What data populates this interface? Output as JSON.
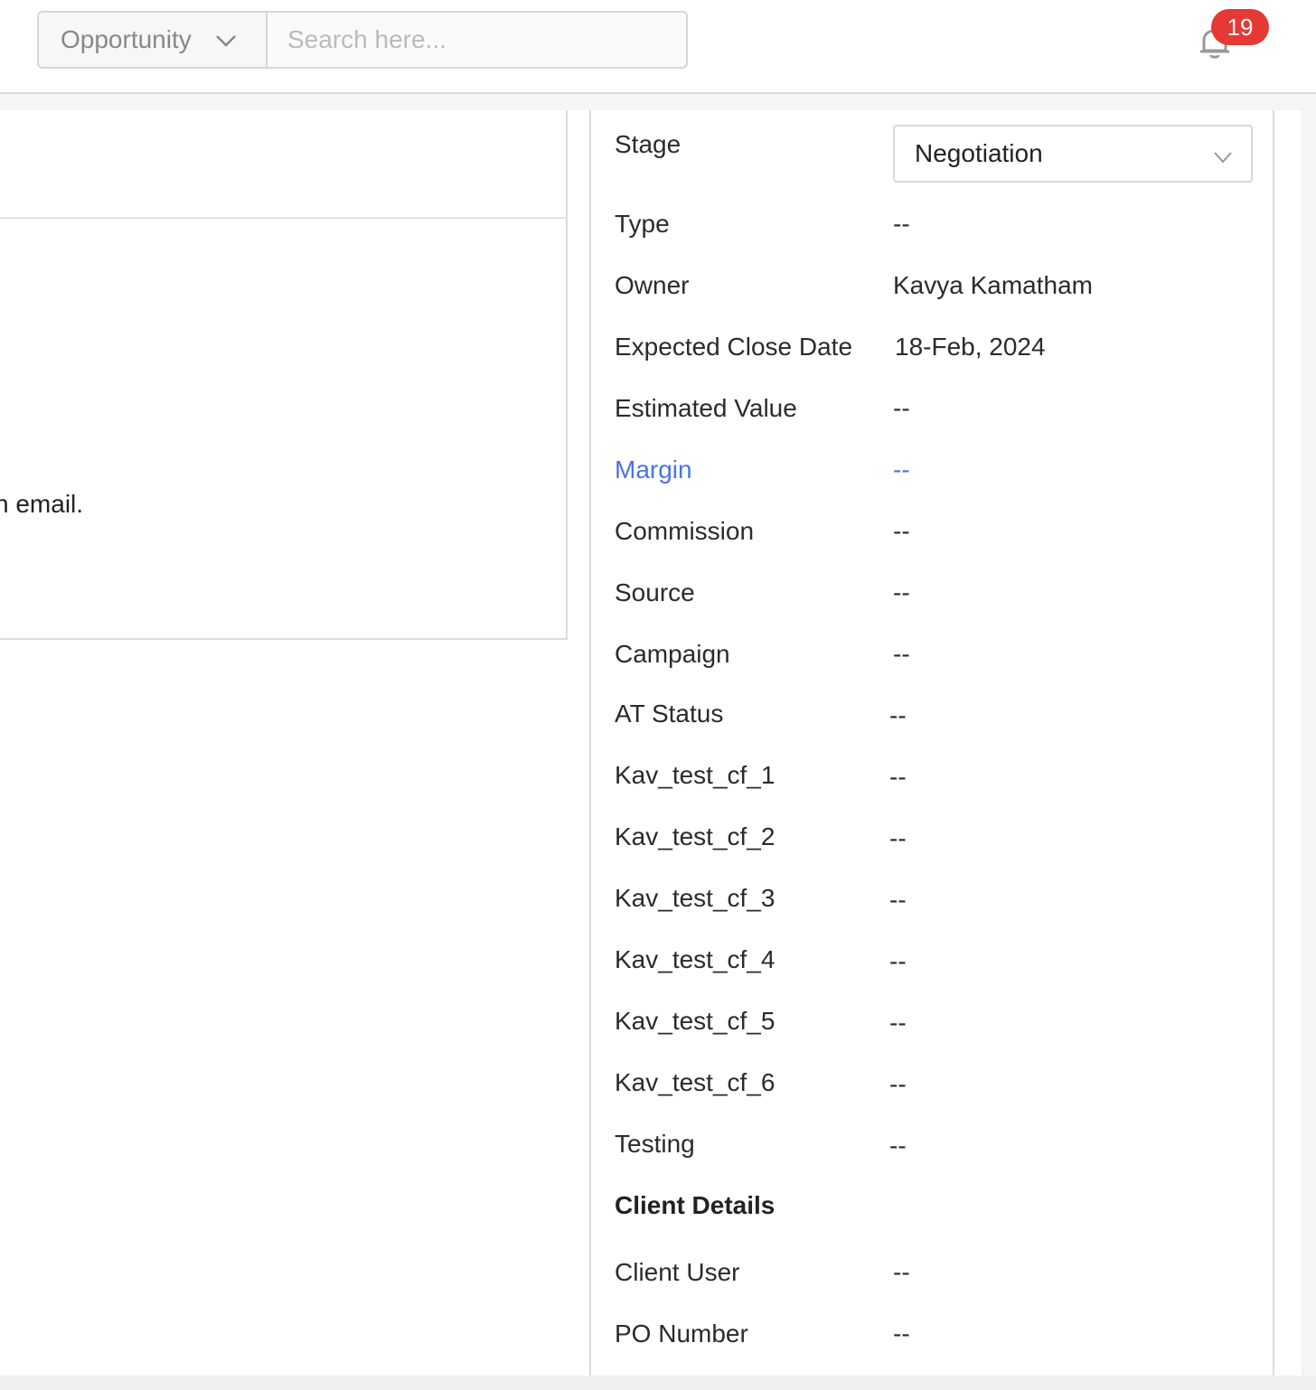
{
  "header": {
    "entity_select": "Opportunity",
    "search_placeholder": "Search here...",
    "notification_count": "19"
  },
  "left_panel": {
    "visible_text": "n email."
  },
  "details": {
    "stage": {
      "label": "Stage",
      "value": "Negotiation"
    },
    "fields": [
      {
        "label": "Type",
        "value": "--"
      },
      {
        "label": "Owner",
        "value": "Kavya Kamatham"
      },
      {
        "label": "Expected Close Date",
        "value": "18-Feb, 2024"
      },
      {
        "label": "Estimated Value",
        "value": "--"
      },
      {
        "label": "Margin",
        "value": "--"
      },
      {
        "label": "Commission",
        "value": "--"
      },
      {
        "label": "Source",
        "value": "--"
      },
      {
        "label": "Campaign",
        "value": "--"
      },
      {
        "label": "AT Status",
        "value": "--"
      },
      {
        "label": "Kav_test_cf_1",
        "value": "--"
      },
      {
        "label": "Kav_test_cf_2",
        "value": "--"
      },
      {
        "label": "Kav_test_cf_3",
        "value": "--"
      },
      {
        "label": "Kav_test_cf_4",
        "value": "--"
      },
      {
        "label": "Kav_test_cf_5",
        "value": "--"
      },
      {
        "label": "Kav_test_cf_6",
        "value": "--"
      },
      {
        "label": "Testing",
        "value": "--"
      }
    ],
    "client_section": {
      "title": "Client Details",
      "fields": [
        {
          "label": "Client User",
          "value": "--"
        },
        {
          "label": "PO Number",
          "value": "--"
        }
      ]
    }
  },
  "colors": {
    "link": "#4a72e8",
    "badge": "#e53935"
  },
  "icons": {
    "dropdown": "chevron-down-icon",
    "notifications": "bell-icon"
  }
}
